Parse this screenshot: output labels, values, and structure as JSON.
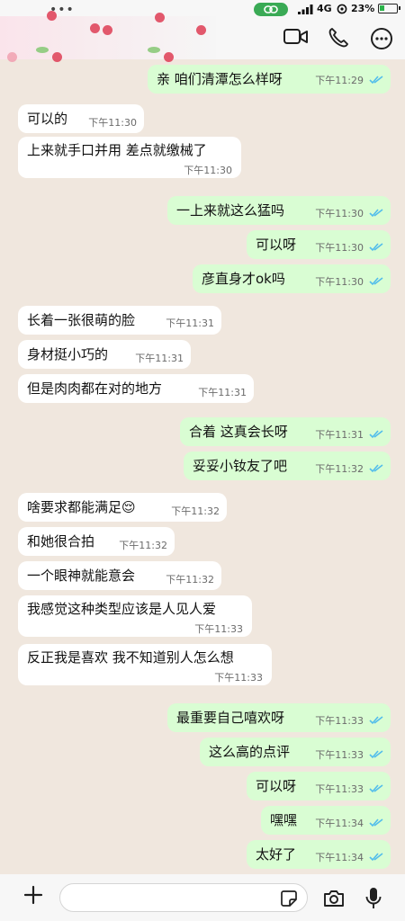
{
  "status_bar": {
    "network": "4G",
    "battery": "23%"
  },
  "header": {
    "icons": [
      "video-call-icon",
      "phone-call-icon",
      "more-options-icon"
    ]
  },
  "messages": [
    {
      "dir": "out",
      "text": "亲 咱们清潭怎么样呀",
      "time": "下午11:29",
      "read": true
    },
    {
      "dir": "in",
      "text": "可以的",
      "time": "下午11:30"
    },
    {
      "dir": "in",
      "text": "上来就手口并用 差点就缴械了",
      "time": "下午11:30"
    },
    {
      "dir": "out",
      "text": "一上来就这么猛吗",
      "time": "下午11:30",
      "read": true
    },
    {
      "dir": "out",
      "text": "可以呀",
      "time": "下午11:30",
      "read": true
    },
    {
      "dir": "out",
      "text": "彦直身才ok吗",
      "time": "下午11:30",
      "read": true
    },
    {
      "dir": "in",
      "text": "长着一张很萌的脸",
      "time": "下午11:31"
    },
    {
      "dir": "in",
      "text": "身材挺小巧的",
      "time": "下午11:31"
    },
    {
      "dir": "in",
      "text": "但是肉肉都在对的地方",
      "time": "下午11:31"
    },
    {
      "dir": "out",
      "text": "合着 这真会长呀",
      "time": "下午11:31",
      "read": true
    },
    {
      "dir": "out",
      "text": "妥妥小钕友了吧",
      "time": "下午11:32",
      "read": true
    },
    {
      "dir": "in",
      "text": "啥要求都能满足😌",
      "time": "下午11:32"
    },
    {
      "dir": "in",
      "text": "和她很合拍",
      "time": "下午11:32"
    },
    {
      "dir": "in",
      "text": "一个眼神就能意会",
      "time": "下午11:32"
    },
    {
      "dir": "in",
      "text": "我感觉这种类型应该是人见人爱",
      "time": "下午11:33"
    },
    {
      "dir": "in",
      "text": "反正我是喜欢 我不知道别人怎么想",
      "time": "下午11:33"
    },
    {
      "dir": "out",
      "text": "最重要自己嘻欢呀",
      "time": "下午11:33",
      "read": true
    },
    {
      "dir": "out",
      "text": "这么高的点评",
      "time": "下午11:33",
      "read": true
    },
    {
      "dir": "out",
      "text": "可以呀",
      "time": "下午11:33",
      "read": true
    },
    {
      "dir": "out",
      "text": "嘿嘿",
      "time": "下午11:34",
      "read": true
    },
    {
      "dir": "out",
      "text": "太好了",
      "time": "下午11:34",
      "read": true
    }
  ],
  "composer": {
    "input_value": ""
  },
  "colors": {
    "chat_background": "#f0e7de",
    "outgoing_bubble": "#d9fdd3",
    "incoming_bubble": "#ffffff",
    "read_ticks": "#53bdeb",
    "accent_green": "#3aaa55"
  }
}
